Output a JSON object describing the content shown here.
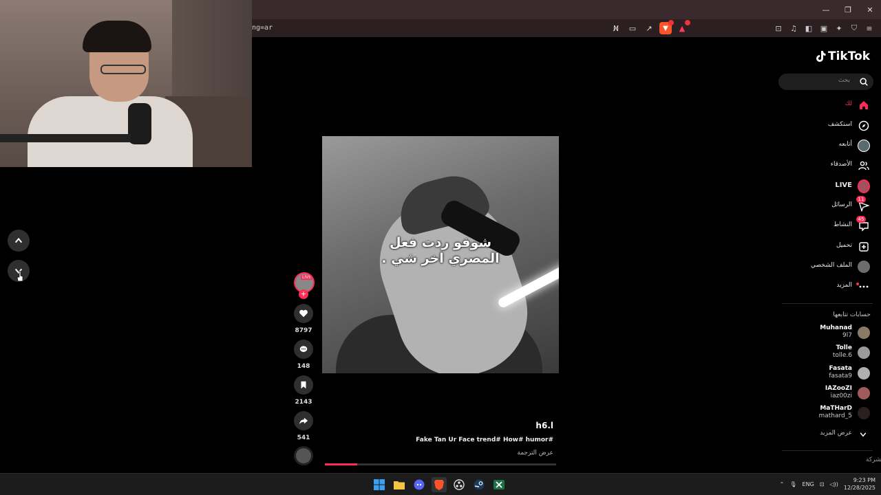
{
  "browser": {
    "url_fragment": "ng=ar",
    "window_controls": [
      "—",
      "❐",
      "✕"
    ]
  },
  "video": {
    "caption_line1": "شوفو ردت فعل",
    "caption_line2": "المصري اخر شي .",
    "author": "h6.l",
    "description": "Fake Tan Ur Face trend# How# humor#",
    "translate_label": "عرض الترجمة",
    "progress_fraction": 0.14
  },
  "actions": {
    "live_tag": "LIVE",
    "likes": "8797",
    "comments": "148",
    "saves": "2143",
    "shares": "541"
  },
  "sidebar": {
    "logo": "TikTok",
    "search_placeholder": "بحث",
    "nav": [
      {
        "label": "لك",
        "icon": "home-icon"
      },
      {
        "label": "استكشف",
        "icon": "compass-icon"
      },
      {
        "label": "أتابعه",
        "icon": "following-avatar-icon"
      },
      {
        "label": "الأصدقاء",
        "icon": "friends-icon"
      },
      {
        "label": "LIVE",
        "icon": "live-avatar-icon"
      },
      {
        "label": "الرسائل",
        "icon": "messages-icon",
        "badge": "11"
      },
      {
        "label": "النشاط",
        "icon": "activity-icon",
        "badge": "45"
      },
      {
        "label": "تحميل",
        "icon": "upload-icon"
      },
      {
        "label": "الملف الشخصي",
        "icon": "profile-icon"
      },
      {
        "label": "المزيد",
        "icon": "more-icon"
      }
    ],
    "following_title": "حسابات تتابعها",
    "accounts": [
      {
        "name": "Muhanad",
        "handle": "9l7"
      },
      {
        "name": "Tolle",
        "handle": "tolle.6"
      },
      {
        "name": "Fasata",
        "handle": "fasata9"
      },
      {
        "name": "IAZooZI",
        "handle": "iaz00zi"
      },
      {
        "name": "MaTHarD",
        "handle": "mathard_5"
      }
    ],
    "see_more": "عرض المزيد",
    "company": "الشركة"
  },
  "taskbar": {
    "lang": "ENG",
    "time": "9:23 PM",
    "date": "12/28/2025"
  },
  "colors": {
    "accent": "#fe2c55",
    "brave": "#fb542b"
  }
}
